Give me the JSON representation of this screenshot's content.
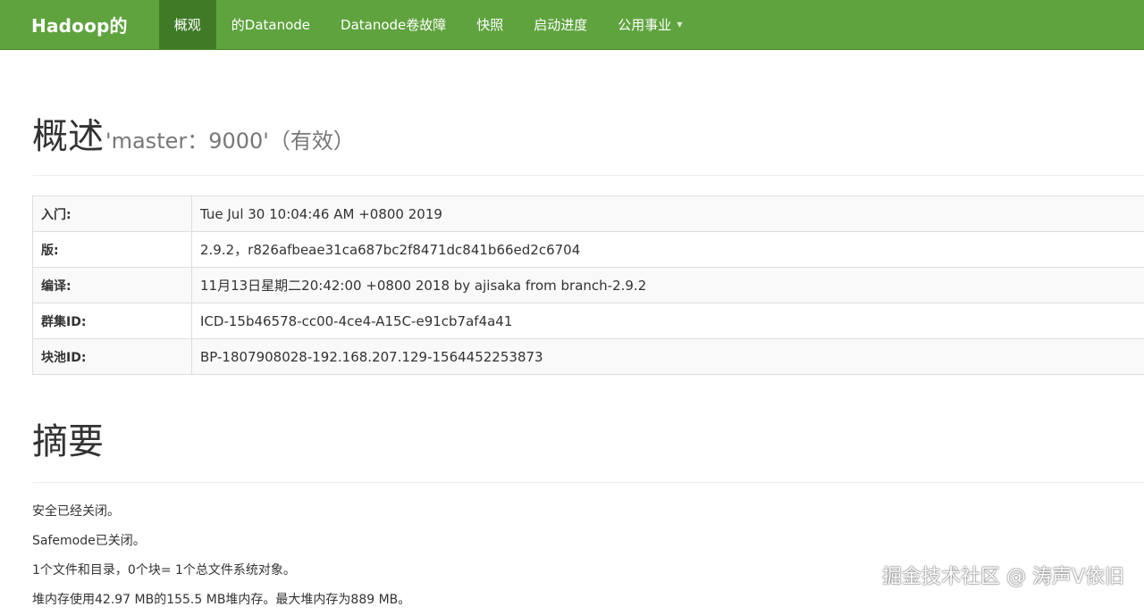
{
  "navbar": {
    "brand": "Hadoop的",
    "items": [
      {
        "label": "概观"
      },
      {
        "label": "的Datanode"
      },
      {
        "label": "Datanode卷故障"
      },
      {
        "label": "快照"
      },
      {
        "label": "启动进度"
      },
      {
        "label": "公用事业"
      }
    ],
    "colors": {
      "bar": "#5fa33e",
      "active": "#3f7b27"
    }
  },
  "overview": {
    "title": "概述",
    "subtitle": "'master：9000'（有效）",
    "rows": [
      {
        "key": "入门:",
        "value": "Tue Jul 30 10:04:46 AM +0800 2019"
      },
      {
        "key": "版:",
        "value": "2.9.2，r826afbeae31ca687bc2f8471dc841b66ed2c6704"
      },
      {
        "key": "编译:",
        "value": "11月13日星期二20:42:00 +0800 2018 by ajisaka from branch-2.9.2"
      },
      {
        "key": "群集ID:",
        "value": "ICD-15b46578-cc00-4ce4-A15C-e91cb7af4a41"
      },
      {
        "key": "块池ID:",
        "value": "BP-1807908028-192.168.207.129-1564452253873"
      }
    ]
  },
  "summary": {
    "title": "摘要",
    "lines": [
      "安全已经关闭。",
      "Safemode已关闭。",
      "1个文件和目录，0个块= 1个总文件系统对象。",
      "堆内存使用42.97 MB的155.5 MB堆内存。最大堆内存为889 MB。"
    ]
  },
  "watermark": "掘金技术社区 @ 涛声V依旧"
}
